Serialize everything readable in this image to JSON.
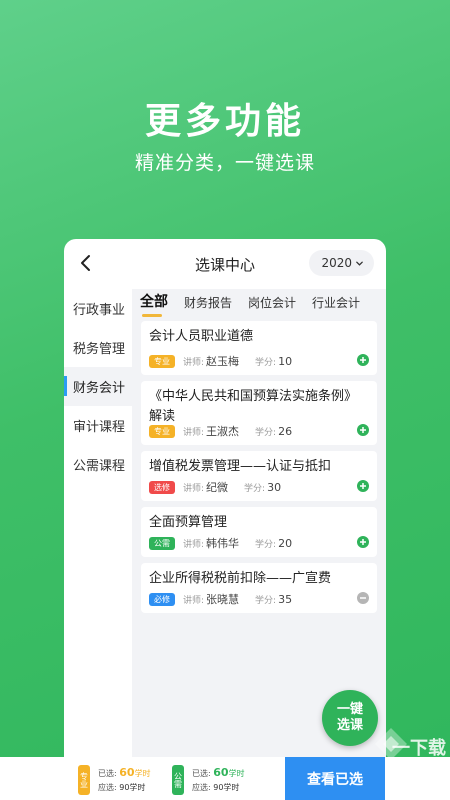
{
  "hero": {
    "title": "更多功能",
    "subtitle": "精准分类，一键选课"
  },
  "header": {
    "title": "选课中心",
    "year": "2020"
  },
  "sidebar": {
    "items": [
      {
        "label": "行政事业"
      },
      {
        "label": "税务管理"
      },
      {
        "label": "财务会计"
      },
      {
        "label": "审计课程"
      },
      {
        "label": "公需课程"
      }
    ],
    "active_index": 2
  },
  "tabs": [
    {
      "label": "全部"
    },
    {
      "label": "财务报告"
    },
    {
      "label": "岗位会计"
    },
    {
      "label": "行业会计"
    }
  ],
  "courses": [
    {
      "title": "会计人员职业道德",
      "badge": "专业",
      "badge_color": "#f5b227",
      "teacher_label": "讲师:",
      "teacher": "赵玉梅",
      "credit_label": "学分:",
      "credit": "10",
      "status": "add"
    },
    {
      "title": "《中华人民共和国预算法实施条例》解读",
      "badge": "专业",
      "badge_color": "#f5b227",
      "teacher_label": "讲师:",
      "teacher": "王淑杰",
      "credit_label": "学分:",
      "credit": "26",
      "status": "add"
    },
    {
      "title": "增值税发票管理——认证与抵扣",
      "badge": "选修",
      "badge_color": "#f04a4a",
      "teacher_label": "讲师:",
      "teacher": "纪微",
      "credit_label": "学分:",
      "credit": "30",
      "status": "add"
    },
    {
      "title": "全面预算管理",
      "badge": "公需",
      "badge_color": "#2fb35a",
      "teacher_label": "讲师:",
      "teacher": "韩伟华",
      "credit_label": "学分:",
      "credit": "20",
      "status": "add"
    },
    {
      "title": "企业所得税税前扣除——广宣费",
      "badge": "必修",
      "badge_color": "#2e8ff2",
      "teacher_label": "讲师:",
      "teacher": "张晓慧",
      "credit_label": "学分:",
      "credit": "35",
      "status": "disabled"
    }
  ],
  "fab": {
    "line1": "一键",
    "line2": "选课"
  },
  "summary": [
    {
      "tag": "专业",
      "tag_color": "#f5b227",
      "selected_label": "已选:",
      "selected": "60",
      "unit": "学时",
      "required_label": "应选:",
      "required": "90学时"
    },
    {
      "tag": "公需",
      "tag_color": "#2fb35a",
      "selected_label": "已选:",
      "selected": "60",
      "unit": "学时",
      "required_label": "应选:",
      "required": "90学时"
    }
  ],
  "view_button": "查看已选",
  "watermark": {
    "text": "一下载",
    "url": "www.yi4.com"
  },
  "colors": {
    "accent_green": "#2fb35a",
    "accent_blue": "#2e8ff2",
    "accent_yellow": "#f1b73a"
  }
}
